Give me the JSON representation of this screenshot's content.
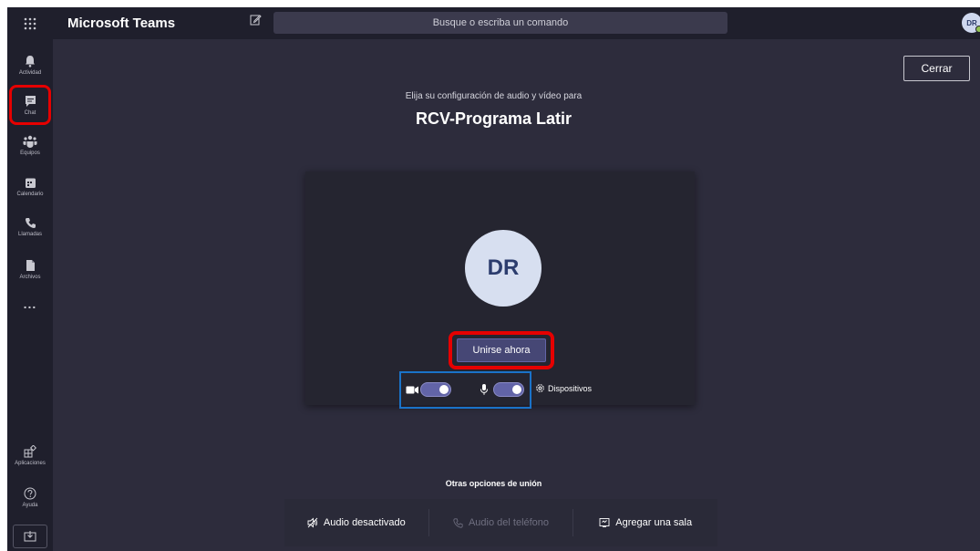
{
  "app": {
    "title": "Microsoft Teams"
  },
  "search": {
    "placeholder": "Busque o escriba un comando"
  },
  "user": {
    "initials": "DR"
  },
  "sidebar": {
    "items": [
      {
        "label": "Actividad",
        "icon": "bell-icon"
      },
      {
        "label": "Chat",
        "icon": "chat-icon"
      },
      {
        "label": "Equipos",
        "icon": "teams-icon"
      },
      {
        "label": "Calendario",
        "icon": "calendar-icon"
      },
      {
        "label": "Llamadas",
        "icon": "phone-icon"
      },
      {
        "label": "Archivos",
        "icon": "file-icon"
      }
    ],
    "more": "...",
    "bottom": [
      {
        "label": "Aplicaciones",
        "icon": "apps-icon"
      },
      {
        "label": "Ayuda",
        "icon": "help-icon"
      }
    ]
  },
  "prejoin": {
    "close_label": "Cerrar",
    "subtitle": "Elija su configuración de audio y vídeo para",
    "meeting_title": "RCV-Programa Latir",
    "avatar_initials": "DR",
    "join_label": "Unirse ahora",
    "camera_on": true,
    "mic_on": true,
    "devices_label": "Dispositivos"
  },
  "other_options": {
    "title": "Otras opciones de unión",
    "items": [
      {
        "label": "Audio desactivado",
        "icon": "speaker-off-icon",
        "enabled": true
      },
      {
        "label": "Audio del teléfono",
        "icon": "phone-icon",
        "enabled": false
      },
      {
        "label": "Agregar una sala",
        "icon": "room-icon",
        "enabled": true
      }
    ]
  },
  "colors": {
    "accent": "#6264a7",
    "highlight_red": "#e60000",
    "highlight_blue": "#1a73c9",
    "background": "#2d2c3c",
    "rail": "#1f1f2c"
  }
}
